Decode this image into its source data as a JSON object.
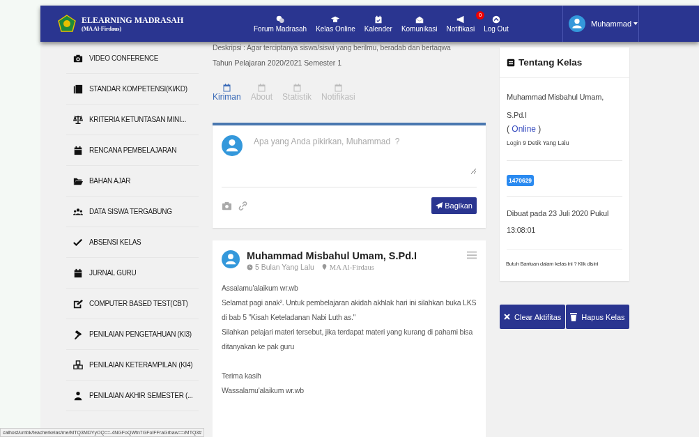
{
  "navbar": {
    "brand": "ELEARNING MADRASAH",
    "school": "(MA Al-Firdaus)",
    "menu": [
      {
        "label": "Forum Madrasah",
        "kind": "forum"
      },
      {
        "label": "Kelas Online",
        "kind": "class"
      },
      {
        "label": "Kalender",
        "kind": "calendar"
      },
      {
        "label": "Komunikasi",
        "kind": "mail"
      },
      {
        "label": "Notifikasi",
        "kind": "notify",
        "badge": "0"
      },
      {
        "label": "Log Out",
        "kind": "logout"
      }
    ],
    "user": "Muhammad"
  },
  "sidebar": {
    "items": [
      {
        "label": "VIDEO CONFERENCE",
        "kind": "camera"
      },
      {
        "label": "STANDAR KOMPETENSI(KI/KD)",
        "kind": "book"
      },
      {
        "label": "KRITERIA KETUNTASAN MINI...",
        "kind": "scale"
      },
      {
        "label": "RENCANA PEMBELAJARAN",
        "kind": "calendar"
      },
      {
        "label": "BAHAN AJAR",
        "kind": "folder"
      },
      {
        "label": "DATA SISWA TERGABUNG",
        "kind": "users"
      },
      {
        "label": "ABSENSI KELAS",
        "kind": "check"
      },
      {
        "label": "JURNAL GURU",
        "kind": "calendar"
      },
      {
        "label": "COMPUTER BASED TEST(CBT)",
        "kind": "edit"
      },
      {
        "label": "PENILAIAN PENGETAHUAN (KI3)",
        "kind": "gavel"
      },
      {
        "label": "PENILAIAN KETERAMPILAN (KI4)",
        "kind": "cubes"
      },
      {
        "label": "PENILAIAN AKHIR SEMESTER (...",
        "kind": "user"
      }
    ]
  },
  "class_info": {
    "description": "Deskripsi : Agar terciptanya siswa/siswi yang berilmu, beradab dan bertaqwa",
    "year": "Tahun Pelajaran 2020/2021 Semester 1"
  },
  "tabs": [
    {
      "label": "Kiriman",
      "selected": true
    },
    {
      "label": "About",
      "selected": false
    },
    {
      "label": "Statistik",
      "selected": false
    },
    {
      "label": "Notifikasi",
      "selected": false
    }
  ],
  "composer": {
    "placeholder": "Apa yang Anda pikirkan, Muhammad  ?",
    "button": "Bagikan"
  },
  "post": {
    "author": "Muhammad Misbahul Umam, S.Pd.I",
    "time": "5 Bulan Yang Lalu",
    "place": "MA Al-Firdaus",
    "paragraphs": [
      [
        "Assalamu'alaikum wr.wb",
        "Selamat pagi anak². Untuk pembelajaran akidah akhlak hari ini silahkan buka LKS di bab 5 \"Kisah Keteladanan Nabi Luth as.\"",
        "Silahkan pelajari materi tersebut, jika terdapat materi yang kurang di pahami bisa ditanyakan ke pak guru"
      ],
      [
        "Terima kasih",
        "Wassalamu'alaikum wr.wb"
      ]
    ]
  },
  "about": {
    "title": "Tentang Kelas",
    "teacher": "Muhammad Misbahul Umam, S.Pd.I",
    "status_open": "( ",
    "status": "Online",
    "status_close": " )",
    "login": "Login 9 Detik Yang Lalu",
    "code": "1470629",
    "created": "Dibuat pada 23 Juli 2020 Pukul 13:08:01",
    "help": "Butuh Bantuan dalam kelas ini ? Klik disini"
  },
  "actions": [
    {
      "label": "Clear Aktifitas",
      "kind": "clear"
    },
    {
      "label": "Hapus Kelas",
      "kind": "delete"
    }
  ],
  "status_bar": "calhost/umbk/teacherkelas/me/MTQ3MDYyOQ==-4NGFoQWtn7GFoIFFraGrbaw==/MTQ3#"
}
